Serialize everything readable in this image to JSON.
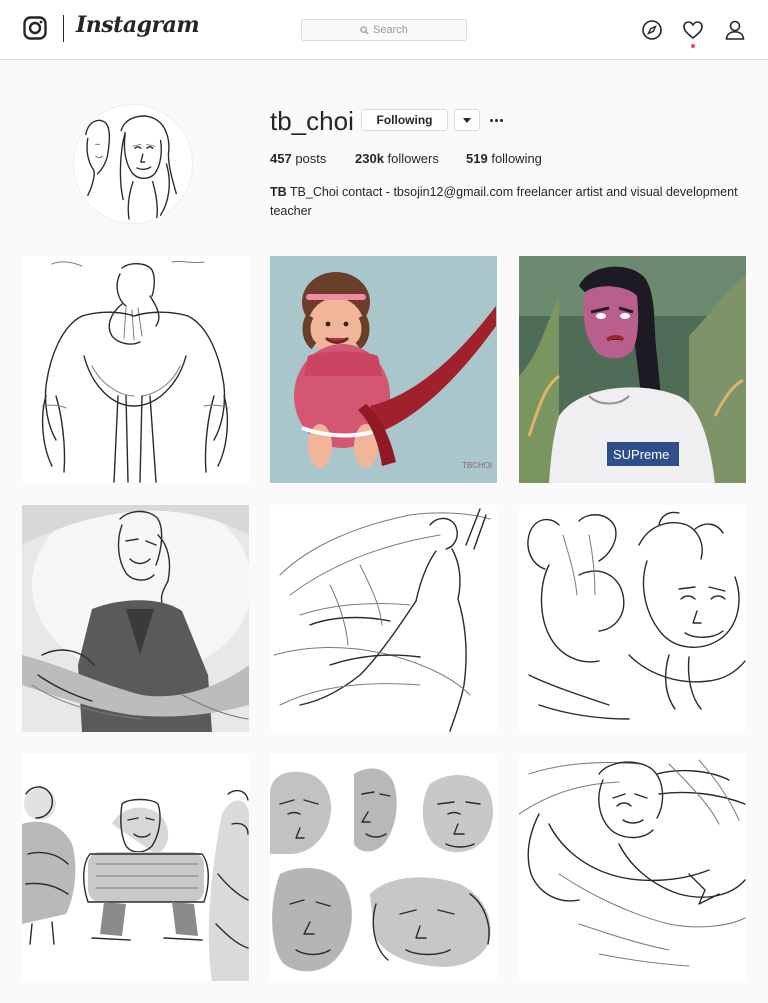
{
  "header": {
    "brand": "Instagram",
    "search_placeholder": "Search",
    "icons": [
      "instagram-logo-icon",
      "search-icon",
      "compass-icon",
      "heart-icon",
      "profile-icon"
    ]
  },
  "profile": {
    "username": "tb_choi",
    "following_button": "Following",
    "stats": {
      "posts_count": "457",
      "posts_label": "posts",
      "followers_count": "230k",
      "followers_label": "followers",
      "following_count": "519",
      "following_label": "following"
    },
    "bio_name": "TB",
    "bio_text": "TB_Choi contact - tbsojin12@gmail.com freelancer artist and visual development teacher"
  },
  "posts": [
    {
      "subject": "character sketch"
    },
    {
      "subject": "painting with red ribbon",
      "signature": "TBCHOI"
    },
    {
      "subject": "painting with shirt",
      "shirt_text": "SUPreme"
    },
    {
      "subject": "character sketch"
    },
    {
      "subject": "character sketch"
    },
    {
      "subject": "character sketch"
    },
    {
      "subject": "character sketch"
    },
    {
      "subject": "character sketch"
    },
    {
      "subject": "character sketch"
    }
  ],
  "colors": {
    "background": "#fafafa",
    "border": "#dbdbdb",
    "text": "#262626",
    "notification": "#ed4956"
  }
}
